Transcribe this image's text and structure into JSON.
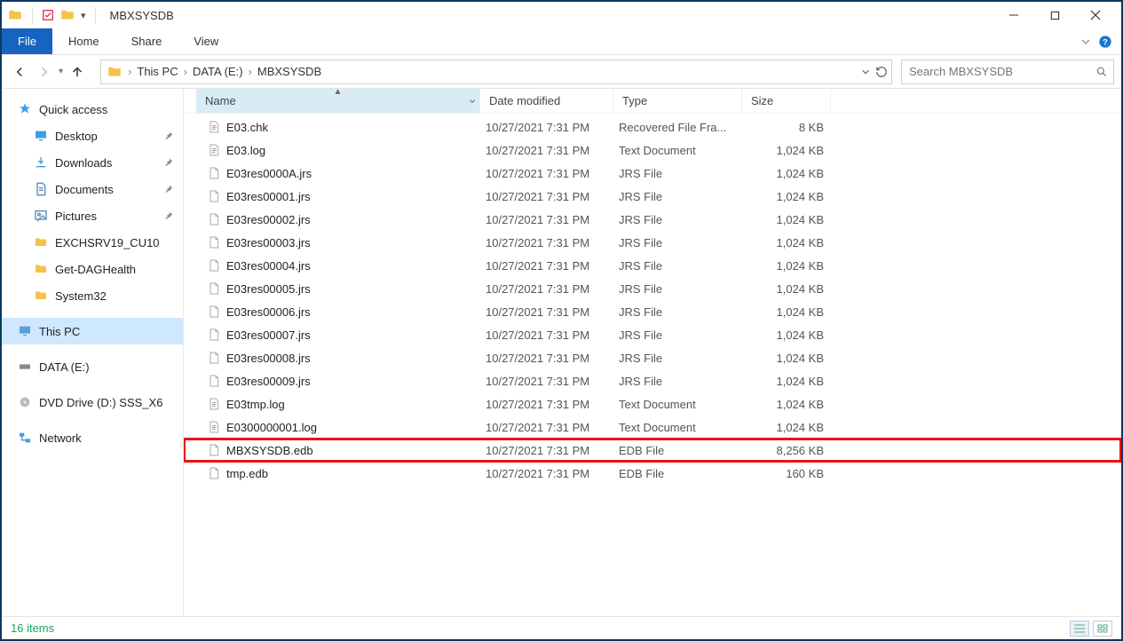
{
  "window": {
    "title": "MBXSYSDB"
  },
  "ribbon": {
    "file": "File",
    "tabs": [
      "Home",
      "Share",
      "View"
    ]
  },
  "nav": {
    "breadcrumbs": [
      "This PC",
      "DATA (E:)",
      "MBXSYSDB"
    ]
  },
  "search": {
    "placeholder": "Search MBXSYSDB"
  },
  "navpane": {
    "quick_access": "Quick access",
    "items_qa": [
      {
        "label": "Desktop",
        "pinned": true
      },
      {
        "label": "Downloads",
        "pinned": true
      },
      {
        "label": "Documents",
        "pinned": true
      },
      {
        "label": "Pictures",
        "pinned": true
      },
      {
        "label": "EXCHSRV19_CU10",
        "pinned": false
      },
      {
        "label": "Get-DAGHealth",
        "pinned": false
      },
      {
        "label": "System32",
        "pinned": false
      }
    ],
    "this_pc": "This PC",
    "data_e": "DATA (E:)",
    "dvd": "DVD Drive (D:) SSS_X6",
    "network": "Network"
  },
  "columns": {
    "name": "Name",
    "date": "Date modified",
    "type": "Type",
    "size": "Size"
  },
  "files": [
    {
      "name": "E03.chk",
      "date": "10/27/2021 7:31 PM",
      "type": "Recovered File Fra...",
      "size": "8 KB",
      "highlight": false
    },
    {
      "name": "E03.log",
      "date": "10/27/2021 7:31 PM",
      "type": "Text Document",
      "size": "1,024 KB",
      "highlight": false
    },
    {
      "name": "E03res0000A.jrs",
      "date": "10/27/2021 7:31 PM",
      "type": "JRS File",
      "size": "1,024 KB",
      "highlight": false
    },
    {
      "name": "E03res00001.jrs",
      "date": "10/27/2021 7:31 PM",
      "type": "JRS File",
      "size": "1,024 KB",
      "highlight": false
    },
    {
      "name": "E03res00002.jrs",
      "date": "10/27/2021 7:31 PM",
      "type": "JRS File",
      "size": "1,024 KB",
      "highlight": false
    },
    {
      "name": "E03res00003.jrs",
      "date": "10/27/2021 7:31 PM",
      "type": "JRS File",
      "size": "1,024 KB",
      "highlight": false
    },
    {
      "name": "E03res00004.jrs",
      "date": "10/27/2021 7:31 PM",
      "type": "JRS File",
      "size": "1,024 KB",
      "highlight": false
    },
    {
      "name": "E03res00005.jrs",
      "date": "10/27/2021 7:31 PM",
      "type": "JRS File",
      "size": "1,024 KB",
      "highlight": false
    },
    {
      "name": "E03res00006.jrs",
      "date": "10/27/2021 7:31 PM",
      "type": "JRS File",
      "size": "1,024 KB",
      "highlight": false
    },
    {
      "name": "E03res00007.jrs",
      "date": "10/27/2021 7:31 PM",
      "type": "JRS File",
      "size": "1,024 KB",
      "highlight": false
    },
    {
      "name": "E03res00008.jrs",
      "date": "10/27/2021 7:31 PM",
      "type": "JRS File",
      "size": "1,024 KB",
      "highlight": false
    },
    {
      "name": "E03res00009.jrs",
      "date": "10/27/2021 7:31 PM",
      "type": "JRS File",
      "size": "1,024 KB",
      "highlight": false
    },
    {
      "name": "E03tmp.log",
      "date": "10/27/2021 7:31 PM",
      "type": "Text Document",
      "size": "1,024 KB",
      "highlight": false
    },
    {
      "name": "E0300000001.log",
      "date": "10/27/2021 7:31 PM",
      "type": "Text Document",
      "size": "1,024 KB",
      "highlight": false
    },
    {
      "name": "MBXSYSDB.edb",
      "date": "10/27/2021 7:31 PM",
      "type": "EDB File",
      "size": "8,256 KB",
      "highlight": true
    },
    {
      "name": "tmp.edb",
      "date": "10/27/2021 7:31 PM",
      "type": "EDB File",
      "size": "160 KB",
      "highlight": false
    }
  ],
  "status": {
    "text": "16 items"
  }
}
